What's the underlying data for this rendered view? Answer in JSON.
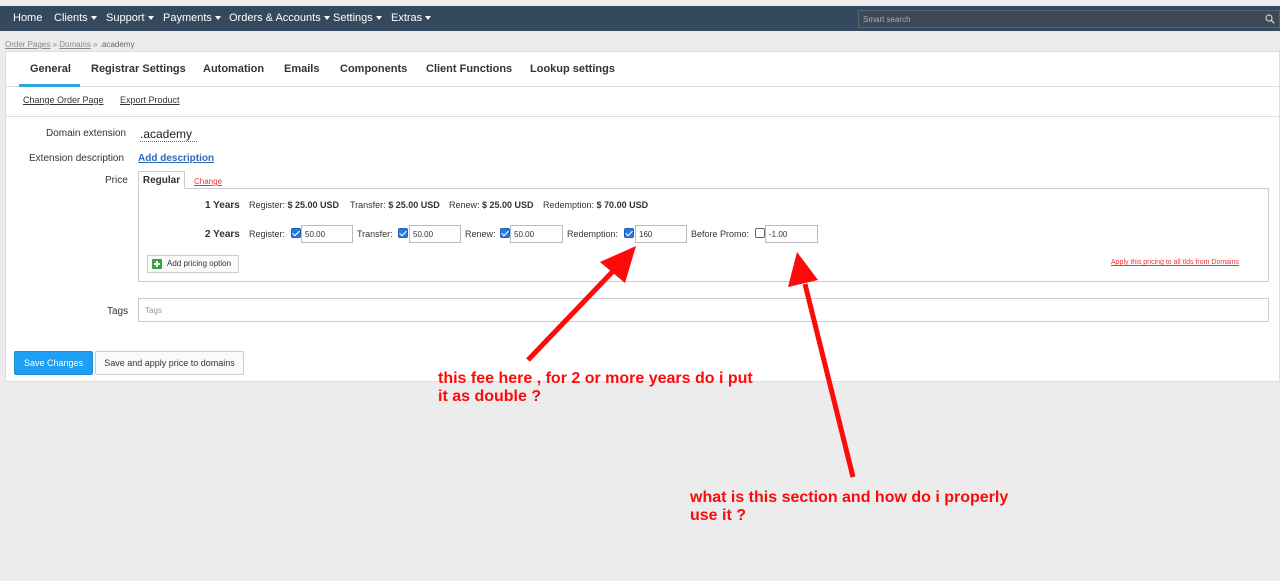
{
  "nav": {
    "items": [
      {
        "label": "Home",
        "dropdown": false
      },
      {
        "label": "Clients",
        "dropdown": true
      },
      {
        "label": "Support",
        "dropdown": true
      },
      {
        "label": "Payments",
        "dropdown": true
      },
      {
        "label": "Orders & Accounts",
        "dropdown": true
      },
      {
        "label": "Settings",
        "dropdown": true
      },
      {
        "label": "Extras",
        "dropdown": true
      }
    ],
    "search_placeholder": "Smart search"
  },
  "breadcrumb": {
    "items": [
      "Order Pages",
      "Domains"
    ],
    "separator": "»",
    "current": ".academy"
  },
  "tabs": [
    "General",
    "Registrar Settings",
    "Automation",
    "Emails",
    "Components",
    "Client Functions",
    "Lookup settings"
  ],
  "active_tab": "General",
  "subnav": {
    "change_order_page": "Change Order Page",
    "export_product": "Export Product"
  },
  "form": {
    "domain_extension_label": "Domain extension",
    "domain_extension_value": ".academy",
    "extension_description_label": "Extension description",
    "add_description": "Add description",
    "price_label": "Price",
    "price_tab": "Regular",
    "price_change": "Change",
    "tags_label": "Tags",
    "tags_placeholder": "Tags"
  },
  "pricing": {
    "row1": {
      "label": "1 Years",
      "register_label": "Register:",
      "register_value": "$ 25.00 USD",
      "transfer_label": "Transfer:",
      "transfer_value": "$ 25.00 USD",
      "renew_label": "Renew:",
      "renew_value": "$ 25.00 USD",
      "redemption_label": "Redemption:",
      "redemption_value": "$ 70.00 USD"
    },
    "row2": {
      "label": "2 Years",
      "register_label": "Register:",
      "register_value": "50.00",
      "register_checked": true,
      "transfer_label": "Transfer:",
      "transfer_value": "50.00",
      "transfer_checked": true,
      "renew_label": "Renew:",
      "renew_value": "50.00",
      "renew_checked": true,
      "redemption_label": "Redemption:",
      "redemption_value": "160",
      "redemption_checked": true,
      "before_promo_label": "Before Promo:",
      "before_promo_value": "-1.00",
      "before_promo_checked": false
    },
    "add_option": "Add pricing option",
    "apply_link": "Apply this pricing to all tlds from Domains"
  },
  "buttons": {
    "save": "Save Changes",
    "save_apply": "Save and apply price to domains"
  },
  "annotations": {
    "note1_line1": "this fee here , for 2 or more years do i put",
    "note1_line2": "it as double ?",
    "note2_line1": "what is this section and how do i properly",
    "note2_line2": "use it ?",
    "color": "#ff0a0a"
  },
  "colors": {
    "nav_bg": "#34495e",
    "primary": "#1d9ff5",
    "tab_active": "#2da7e0",
    "link": "#2e68b5"
  }
}
